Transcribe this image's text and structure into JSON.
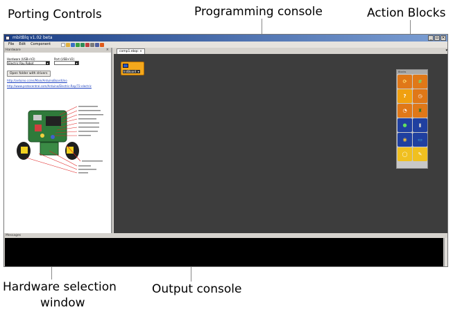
{
  "callouts": {
    "porting_controls": "Porting Controls",
    "programming_console": "Programming console",
    "action_blocks": "Action Blocks",
    "hardware_selection_line1": "Hardware selection",
    "hardware_selection_line2": "window",
    "output_console": "Output console"
  },
  "app": {
    "title": "mbitBlq v1.02 beta",
    "menu": [
      "File",
      "Edit",
      "Component"
    ]
  },
  "hardware_panel": {
    "header": "Hardware",
    "hardware_label": "Hardware (USB+V2)",
    "port_label": "Port (USB+V2)",
    "hardware_value": "Electric Ray Robot",
    "port_value": "",
    "drivers_button": "Open folder with drivers",
    "link1": "http://arduino.cc/en/Main/ArduinoBoardUno",
    "link2": "http://www.protocentral.com/Arduino/Electric-Ray/72-electric"
  },
  "workspace": {
    "tab_label": "comp1.ebqc",
    "block_label": "InitBoard"
  },
  "palette": {
    "header": "Blocks"
  },
  "messages": {
    "header": "Messages"
  },
  "colors": {
    "workspace_bg": "#3d3d3d",
    "block_orange": "#f4a81c",
    "console_bg": "#000000"
  }
}
